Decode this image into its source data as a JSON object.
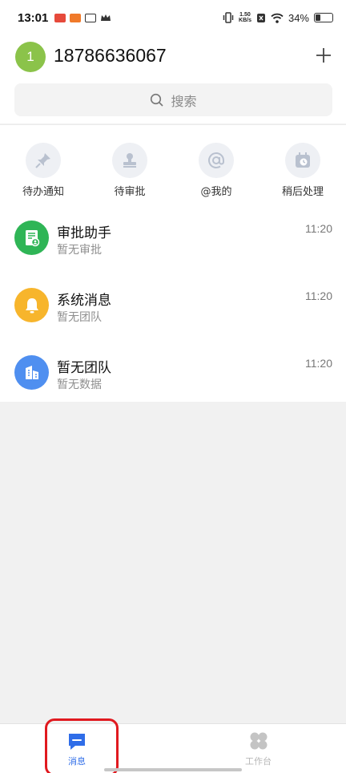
{
  "status_bar": {
    "time": "13:01",
    "speed_value": "1.50",
    "speed_unit": "KB/s",
    "battery": "34%",
    "battery_level": 0.34
  },
  "header": {
    "avatar_text": "1",
    "user_name": "18786636067",
    "search_placeholder": "搜索"
  },
  "quick_actions": [
    {
      "label": "待办通知",
      "icon": "pin-icon"
    },
    {
      "label": "待审批",
      "icon": "stamp-icon"
    },
    {
      "label": "@我的",
      "icon": "at-icon"
    },
    {
      "label": "稍后处理",
      "icon": "calendar-clock-icon"
    }
  ],
  "messages": [
    {
      "title": "审批助手",
      "subtitle": "暂无审批",
      "time": "11:20",
      "icon": "approval-doc-icon",
      "color": "#2fb556"
    },
    {
      "title": "系统消息",
      "subtitle": "暂无团队",
      "time": "11:20",
      "icon": "bell-icon",
      "color": "#f7b52c"
    },
    {
      "title": "暂无团队",
      "subtitle": "暂无数据",
      "time": "11:20",
      "icon": "building-icon",
      "color": "#4f8ff0"
    }
  ],
  "tabs": [
    {
      "label": "消息",
      "icon": "chat-bubble-icon",
      "active": true,
      "color": "#2f6de8"
    },
    {
      "label": "工作台",
      "icon": "clover-grid-icon",
      "active": false,
      "color": "#b7b7b7"
    }
  ]
}
